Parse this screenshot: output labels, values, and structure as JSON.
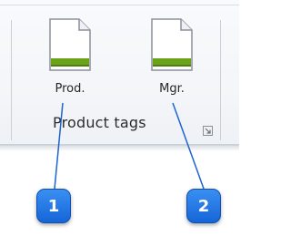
{
  "ribbon_group": {
    "title": "Product tags",
    "buttons": [
      {
        "label": "Prod.",
        "icon": "document-icon"
      },
      {
        "label": "Mgr.",
        "icon": "document-icon"
      }
    ],
    "launcher_icon": "dialog-launcher-icon"
  },
  "callouts": [
    {
      "number": "1"
    },
    {
      "number": "2"
    }
  ],
  "colors": {
    "icon_bar": "#6aa31a",
    "badge": "#1f6fe0",
    "callout_line": "#1e64d3"
  }
}
